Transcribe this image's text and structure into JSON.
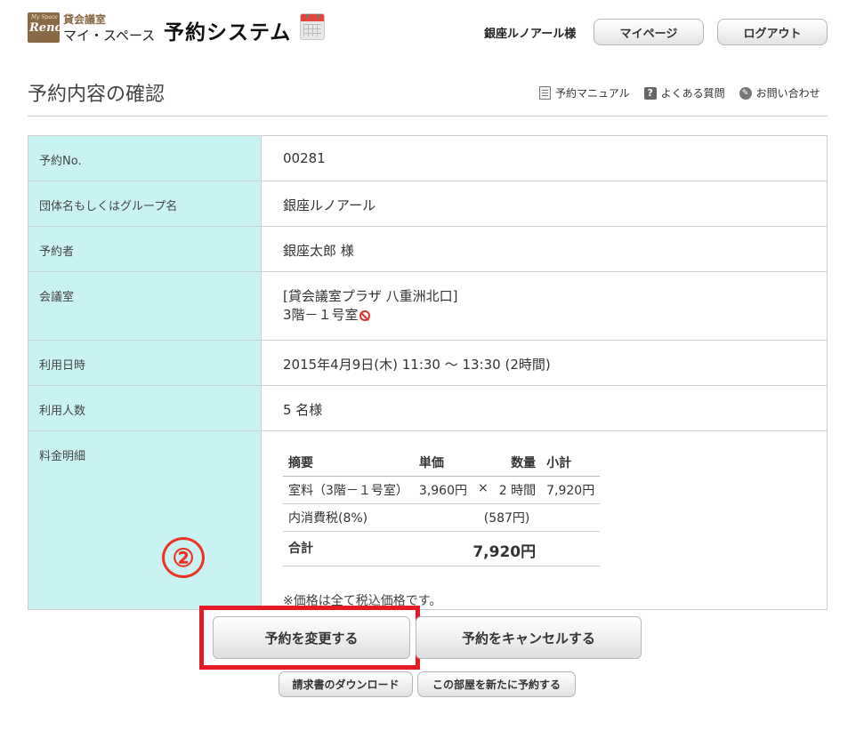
{
  "header": {
    "logo_small": "My Space",
    "logo_big": "Renoir",
    "brand_top": "貸会議室",
    "brand_bottom": "マイ・スペース",
    "system_title": "予約システム",
    "user_name": "銀座ルノアール様",
    "mypage_label": "マイページ",
    "logout_label": "ログアウト"
  },
  "page": {
    "title": "予約内容の確認",
    "links": [
      {
        "label": "予約マニュアル",
        "icon": "manual-icon"
      },
      {
        "label": "よくある質問",
        "icon": "faq-icon"
      },
      {
        "label": "お問い合わせ",
        "icon": "contact-icon"
      }
    ]
  },
  "reservation": {
    "no_label": "予約No.",
    "no_value": "00281",
    "group_label": "団体名もしくはグループ名",
    "group_value": "銀座ルノアール",
    "person_label": "予約者",
    "person_value": "銀座太郎 様",
    "room_label": "会議室",
    "room_line1": "[貸会議室プラザ 八重洲北口]",
    "room_line2": "3階－１号室",
    "datetime_label": "利用日時",
    "datetime_value": "2015年4月9日(木) 11:30 ～ 13:30 (2時間)",
    "people_label": "利用人数",
    "people_value": "5 名様",
    "fee_label": "料金明細"
  },
  "fee": {
    "headers": {
      "summary": "摘要",
      "unit_price": "単価",
      "quantity": "数量",
      "subtotal": "小計"
    },
    "room_row": {
      "summary": "室料（3階－１号室）",
      "unit_price": "3,960円",
      "times": "×",
      "quantity": "2 時間",
      "subtotal": "7,920円"
    },
    "tax_row": {
      "summary": "内消費税(8%)",
      "value": "(587円)"
    },
    "total_row": {
      "summary": "合計",
      "value": "7,920円"
    },
    "note": "※価格は全て税込価格です。"
  },
  "annotation": {
    "marker": "②",
    "color": "#e21b24"
  },
  "actions": {
    "change_label": "予約を変更する",
    "cancel_label": "予約をキャンセルする",
    "invoice_label": "請求書のダウンロード",
    "rebook_label": "この部屋を新たに予約する"
  },
  "colors": {
    "label_bg": "#c9f3f3",
    "brand": "#8a6a44"
  }
}
